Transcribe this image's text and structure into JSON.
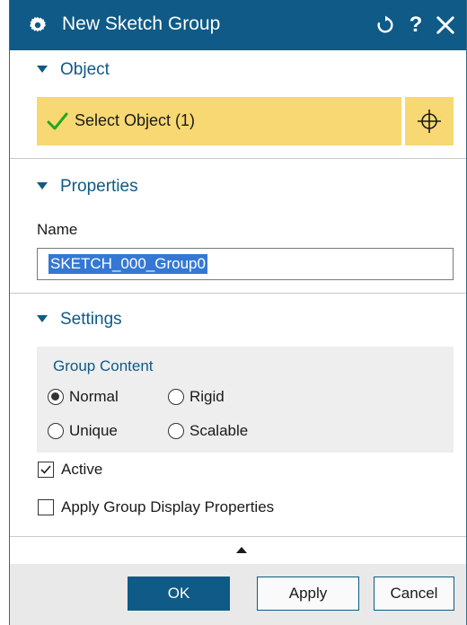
{
  "titlebar": {
    "title": "New Sketch Group",
    "help_label": "?"
  },
  "object_section": {
    "title": "Object",
    "select_label": "Select Object (1)"
  },
  "properties_section": {
    "title": "Properties",
    "name_label": "Name",
    "name_value": "SKETCH_000_Group0"
  },
  "settings_section": {
    "title": "Settings",
    "group_content_title": "Group Content",
    "options": [
      {
        "label": "Normal",
        "selected": true
      },
      {
        "label": "Rigid",
        "selected": false
      },
      {
        "label": "Unique",
        "selected": false
      },
      {
        "label": "Scalable",
        "selected": false
      }
    ],
    "active_label": "Active",
    "active_checked": true,
    "apply_display_label": "Apply Group Display Properties",
    "apply_display_checked": false
  },
  "buttons": {
    "ok": "OK",
    "apply": "Apply",
    "cancel": "Cancel"
  },
  "colors": {
    "accent": "#0f5a86",
    "selection_highlight": "#f7d873",
    "check_green": "#22a822"
  }
}
